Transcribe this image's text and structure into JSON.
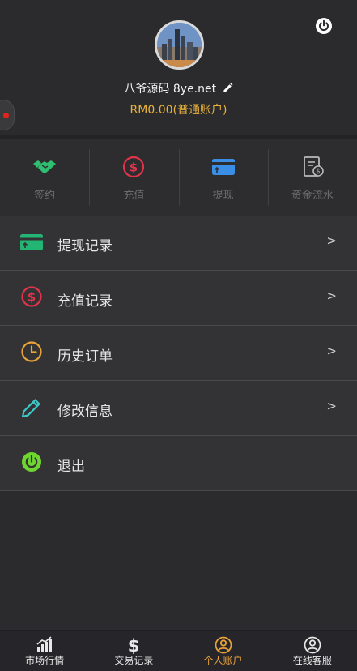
{
  "profile": {
    "username": "八爷源码 8ye.net",
    "balance": "RM0.00(普通账户)",
    "power_icon": "power-icon",
    "edit_icon": "pencil-icon"
  },
  "quick_actions": [
    {
      "label": "签约",
      "icon": "handshake-icon",
      "color": "#2fbf71"
    },
    {
      "label": "充值",
      "icon": "dollar-circle-icon",
      "color": "#e2334a"
    },
    {
      "label": "提现",
      "icon": "card-icon",
      "color": "#3a8ee6"
    },
    {
      "label": "资金流水",
      "icon": "ledger-icon",
      "color": "#b9b9b9"
    }
  ],
  "menu": [
    {
      "label": "提现记录",
      "icon": "card-icon",
      "color": "#22b573",
      "arrow": ">"
    },
    {
      "label": "充值记录",
      "icon": "dollar-circle-icon",
      "color": "#e2334a",
      "arrow": ">"
    },
    {
      "label": "历史订单",
      "icon": "clock-icon",
      "color": "#e9a23a",
      "arrow": ">"
    },
    {
      "label": "修改信息",
      "icon": "pencil-icon",
      "color": "#3cc9c9",
      "arrow": ">"
    },
    {
      "label": "退出",
      "icon": "power-icon",
      "color": "#6fd62f",
      "arrow": ""
    }
  ],
  "tabbar": [
    {
      "label": "市场行情",
      "icon": "chart-icon",
      "active": false
    },
    {
      "label": "交易记录",
      "icon": "dollar-icon",
      "active": false
    },
    {
      "label": "个人账户",
      "icon": "user-circle-icon",
      "active": true
    },
    {
      "label": "在线客服",
      "icon": "user-circle-icon",
      "active": false
    }
  ],
  "colors": {
    "accent": "#e9a23a",
    "background": "#2b2b2d"
  }
}
